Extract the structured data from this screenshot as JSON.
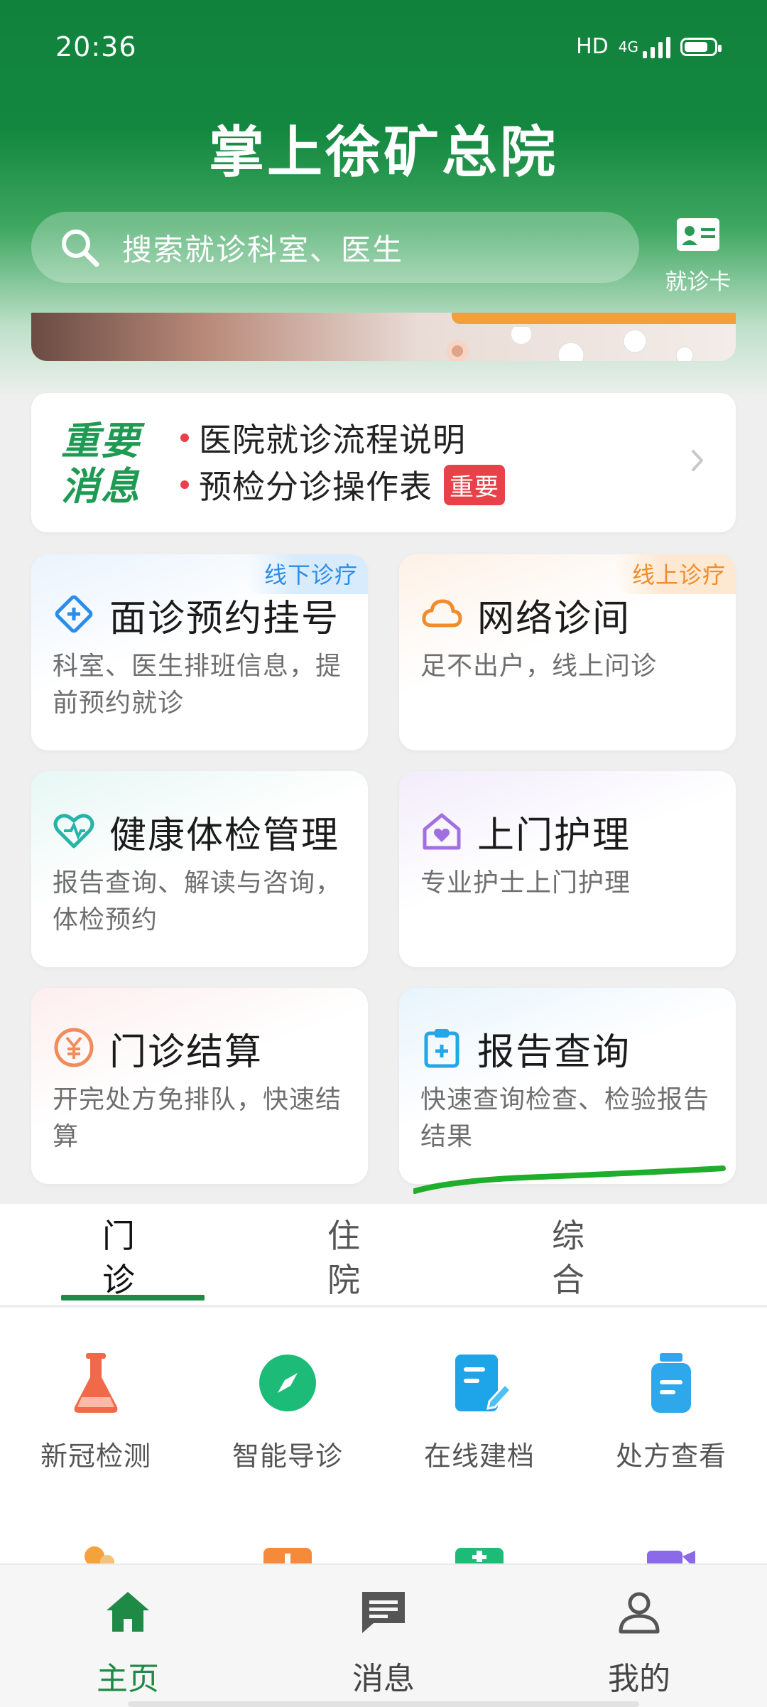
{
  "status_bar": {
    "time": "20:36",
    "hd": "HD",
    "network": "4G"
  },
  "header": {
    "title": "掌上徐矿总院",
    "search_placeholder": "搜索就诊科室、医生",
    "card_label": "就诊卡"
  },
  "notice": {
    "tag_line1": "重要",
    "tag_line2": "消息",
    "items": [
      {
        "text": "医院就诊流程说明"
      },
      {
        "text": "预检分诊操作表",
        "badge": "重要"
      }
    ]
  },
  "services": [
    {
      "title": "面诊预约挂号",
      "desc": "科室、医生排班信息，提前预约就诊",
      "tag": "线下诊疗",
      "icon": "plus-diamond-icon",
      "color": "#2c8de8"
    },
    {
      "title": "网络诊间",
      "desc": "足不出户，线上问诊",
      "tag": "线上诊疗",
      "icon": "cloud-icon",
      "color": "#f08c2c"
    },
    {
      "title": "健康体检管理",
      "desc": "报告查询、解读与咨询，体检预约",
      "icon": "heart-icon",
      "color": "#28b3a8"
    },
    {
      "title": "上门护理",
      "desc": "专业护士上门护理",
      "icon": "house-heart-icon",
      "color": "#a070e0"
    },
    {
      "title": "门诊结算",
      "desc": "开完处方免排队，快速结算",
      "icon": "yen-circle-icon",
      "color": "#f08c5c"
    },
    {
      "title": "报告查询",
      "desc": "快速查询检查、检验报告结果",
      "icon": "clipboard-icon",
      "color": "#22a7e8"
    }
  ],
  "tabs": [
    {
      "label": "门诊",
      "active": true
    },
    {
      "label": "住院",
      "active": false
    },
    {
      "label": "综合",
      "active": false
    }
  ],
  "quick_actions": [
    {
      "label": "新冠检测",
      "icon": "flask-icon",
      "color": "#f06a4a"
    },
    {
      "label": "智能导诊",
      "icon": "compass-icon",
      "color": "#1dbb78"
    },
    {
      "label": "在线建档",
      "icon": "document-edit-icon",
      "color": "#1ea4e8"
    },
    {
      "label": "处方查看",
      "icon": "medicine-bottle-icon",
      "color": "#2ea8ea"
    }
  ],
  "bottom_nav": [
    {
      "label": "主页",
      "icon": "home-icon",
      "active": true
    },
    {
      "label": "消息",
      "icon": "message-icon",
      "active": false
    },
    {
      "label": "我的",
      "icon": "profile-icon",
      "active": false
    }
  ],
  "colors": {
    "primary": "#13873f",
    "accent_green": "#1e8a45",
    "badge_red": "#e8414a"
  }
}
